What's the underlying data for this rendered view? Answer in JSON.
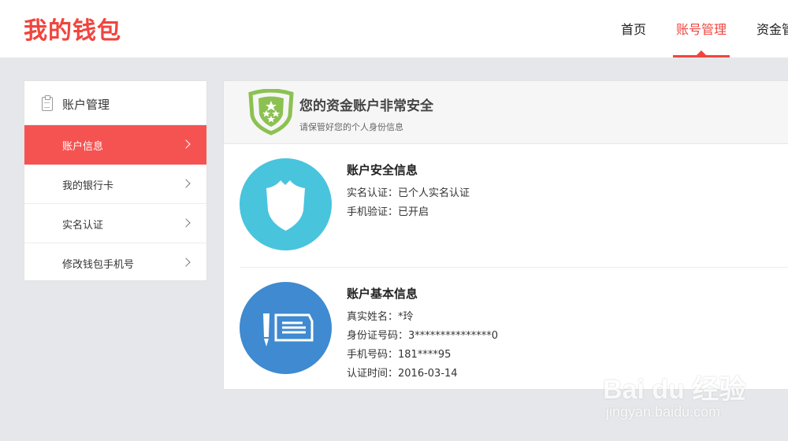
{
  "header": {
    "logo": "我的钱包",
    "nav": [
      {
        "label": "首页"
      },
      {
        "label": "账号管理"
      },
      {
        "label": "资金管"
      }
    ],
    "accent": "#f0453e"
  },
  "sidebar": {
    "title": "账户管理",
    "items": [
      {
        "label": "账户信息"
      },
      {
        "label": "我的银行卡"
      },
      {
        "label": "实名认证"
      },
      {
        "label": "修改钱包手机号"
      }
    ]
  },
  "banner": {
    "title": "您的资金账户非常安全",
    "subtitle": "请保管好您的个人身份信息"
  },
  "security_info": {
    "title": "账户安全信息",
    "lines": [
      "实名认证：已个人实名认证",
      "手机验证：已开启"
    ],
    "icon_color": "#48c4dd"
  },
  "basic_info": {
    "title": "账户基本信息",
    "lines": [
      "真实姓名：*玲",
      "身份证号码：3***************0",
      "手机号码：181****95",
      "认证时间：2016-03-14"
    ],
    "icon_color": "#3f8ad0"
  },
  "watermark": {
    "brand": "Bai du 经验",
    "url": "jingyan.baidu.com"
  }
}
